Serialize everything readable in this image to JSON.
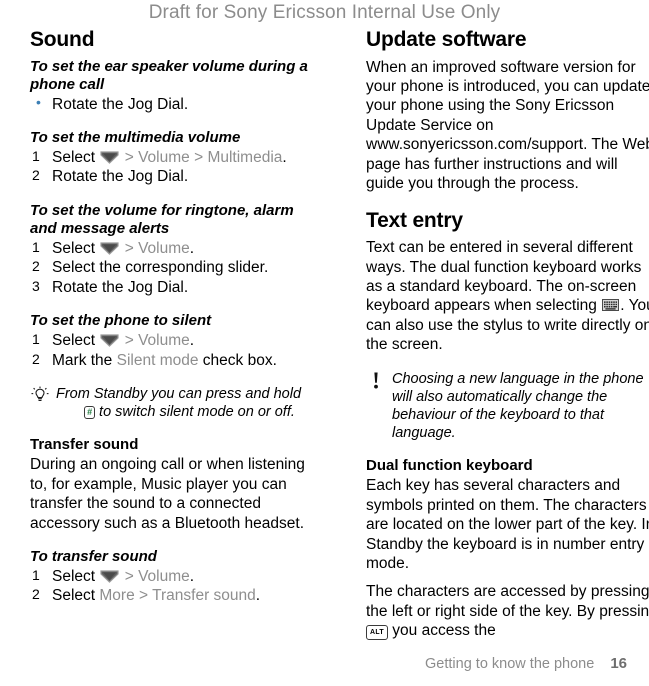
{
  "watermark": "Draft for Sony Ericsson Internal Use Only",
  "icons": {
    "nav_chevron": "chevron-down-icon",
    "keyboard": "keyboard-icon",
    "tip_bulb": "lightbulb-icon",
    "note_exclamation": "exclamation-icon",
    "hash_key": "#",
    "alt_key": "ALT"
  },
  "colors": {
    "watermark": "#8c8c8c",
    "ui_reference": "#8e8e8e",
    "bullet": "#3b7fb5",
    "footer": "#8c8c8c",
    "hash_key_green": "#1f7a3f"
  },
  "left": {
    "section_title": "Sound",
    "proc1": {
      "heading": "To set the ear speaker volume during a phone call",
      "steps": [
        {
          "marker": "•",
          "text": "Rotate the Jog Dial."
        }
      ]
    },
    "proc2": {
      "heading": "To set the multimedia volume",
      "steps": [
        {
          "num": "1",
          "pre": "Select ",
          "icon": true,
          "parts": [
            {
              "t": " > ",
              "style": "sep"
            },
            {
              "t": "Volume",
              "style": "ui"
            },
            {
              "t": " > ",
              "style": "sep"
            },
            {
              "t": "Multimedia",
              "style": "ui"
            },
            {
              "t": ".",
              "style": "plain"
            }
          ]
        },
        {
          "num": "2",
          "text": "Rotate the Jog Dial."
        }
      ]
    },
    "proc3": {
      "heading": "To set the volume for ringtone, alarm and message alerts",
      "steps": [
        {
          "num": "1",
          "pre": "Select ",
          "icon": true,
          "parts": [
            {
              "t": " > ",
              "style": "sep"
            },
            {
              "t": "Volume",
              "style": "ui"
            },
            {
              "t": ".",
              "style": "plain"
            }
          ]
        },
        {
          "num": "2",
          "text": "Select the corresponding slider."
        },
        {
          "num": "3",
          "text": "Rotate the Jog Dial."
        }
      ]
    },
    "proc4": {
      "heading": "To set the phone to silent",
      "steps": [
        {
          "num": "1",
          "pre": "Select ",
          "icon": true,
          "parts": [
            {
              "t": " > ",
              "style": "sep"
            },
            {
              "t": "Volume",
              "style": "ui"
            },
            {
              "t": ".",
              "style": "plain"
            }
          ]
        },
        {
          "num": "2",
          "pre": "Mark the ",
          "parts": [
            {
              "t": "Silent mode",
              "style": "ui"
            },
            {
              "t": " check box.",
              "style": "plain"
            }
          ]
        }
      ]
    },
    "tip": {
      "line1": "From Standby you can press and hold",
      "line2_after_key": "to switch silent mode on or off."
    },
    "transfer": {
      "heading": "Transfer sound",
      "body": "During an ongoing call or when listening to, for example, Music player you can transfer the sound to a connected accessory such as a Bluetooth headset."
    },
    "proc5": {
      "heading": "To transfer sound",
      "steps": [
        {
          "num": "1",
          "pre": "Select ",
          "icon": true,
          "parts": [
            {
              "t": " > ",
              "style": "sep"
            },
            {
              "t": "Volume",
              "style": "ui"
            },
            {
              "t": ".",
              "style": "plain"
            }
          ]
        },
        {
          "num": "2",
          "pre": "Select ",
          "parts": [
            {
              "t": "More",
              "style": "ui"
            },
            {
              "t": " > ",
              "style": "sep"
            },
            {
              "t": "Transfer sound",
              "style": "ui"
            },
            {
              "t": ".",
              "style": "plain"
            }
          ]
        }
      ]
    }
  },
  "right": {
    "update": {
      "title": "Update software",
      "body": "When an improved software version for your phone is introduced, you can update your phone using the Sony Ericsson Update Service on www.sonyericsson.com/support. The Web page has further instructions and will guide you through the process."
    },
    "text_entry": {
      "title": "Text entry",
      "body_before_icon": "Text can be entered in several different ways. The dual function keyboard works as a standard keyboard. The on-screen keyboard appears when selecting ",
      "body_after_icon": ". You can also use the stylus to write directly on the screen."
    },
    "note": {
      "text": "Choosing a new language in the phone will also automatically change the behaviour of the keyboard to that language."
    },
    "dual": {
      "heading": "Dual function keyboard",
      "para1": "Each key has several characters and symbols printed on them. The characters are located on the lower part of the key. In Standby the keyboard is in number entry mode.",
      "para2_before_key": "The characters are accessed by pressing the left or right side of the key. By pressing ",
      "para2_after_key": " you access the"
    }
  },
  "footer": {
    "chapter": "Getting to know the phone",
    "page": "16"
  }
}
